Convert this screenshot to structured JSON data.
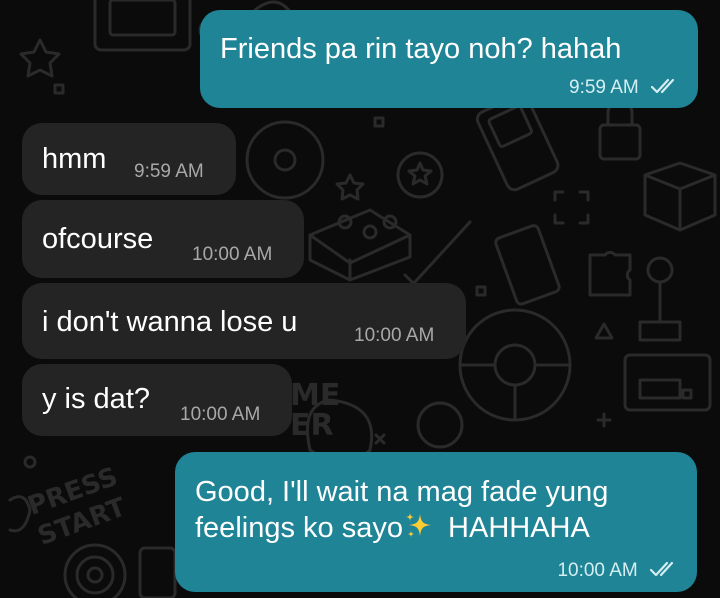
{
  "chat": {
    "messages": [
      {
        "direction": "outgoing",
        "text": "Friends pa rin tayo noh? hahah",
        "time": "9:59 AM",
        "status": "read"
      },
      {
        "direction": "incoming",
        "text": "hmm",
        "time": "9:59 AM"
      },
      {
        "direction": "incoming",
        "text": "ofcourse",
        "time": "10:00 AM"
      },
      {
        "direction": "incoming",
        "text": "i don't wanna lose u",
        "time": "10:00 AM"
      },
      {
        "direction": "incoming",
        "text": "y is dat?",
        "time": "10:00 AM"
      },
      {
        "direction": "outgoing",
        "text_line1": "Good, I'll wait na mag fade yung",
        "text_line2_start": "feelings ko sayo",
        "text_line2_emoji": "sparkles-emoji",
        "text_line2_end": "HAHHAHA",
        "time": "10:00 AM",
        "status": "read"
      }
    ],
    "wallpaper": {
      "text_press": "PRESS",
      "text_start": "START",
      "text_game": "ME",
      "text_over": "ER"
    }
  },
  "colors": {
    "background": "#0b0b0b",
    "outgoing_bubble": "#1f8496",
    "incoming_bubble": "#242424",
    "text": "#ffffff"
  }
}
